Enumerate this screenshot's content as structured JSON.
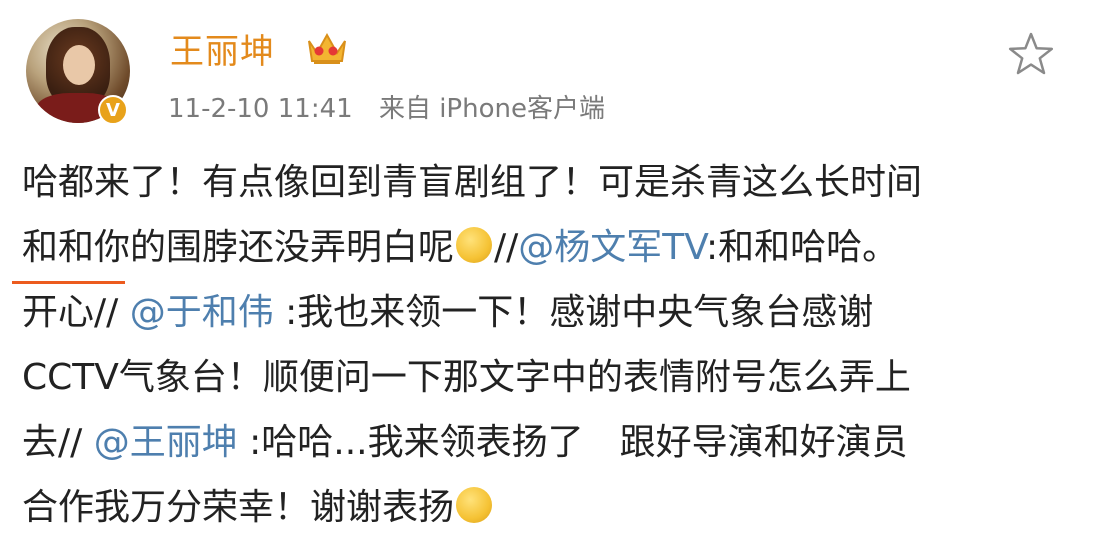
{
  "post": {
    "username": "王丽坤",
    "timestamp": "11-2-10 11:41",
    "source": "来自 iPhone客户端",
    "icons": {
      "verified": "verified-v-badge",
      "vip": "crown-icon",
      "favorite": "star-icon",
      "emoji": "smiley-emoji-icon"
    },
    "verified_badge_text": "V",
    "lines": [
      {
        "text": "哈都来了！有点像回到青盲剧组了！可是杀青这么长时间"
      },
      {
        "pre": "和和你的围脖还没弄明白呢",
        "sep": "//",
        "mention": "@杨文军TV",
        "post": ":和和哈哈。"
      },
      {
        "pre": "开心// ",
        "mention": "@于和伟",
        "post": " :我也来领一下！感谢中央气象台感谢"
      },
      {
        "text": "CCTV气象台！顺便问一下那文字中的表情附号怎么弄上"
      },
      {
        "pre": "去// ",
        "mention": "@王丽坤",
        "post": " :哈哈...我来领表扬了　跟好导演和好演员"
      },
      {
        "text": "合作我万分荣幸！谢谢表扬"
      }
    ]
  },
  "colors": {
    "username": "#e38a1c",
    "mention": "#4e7fae",
    "meta": "#7a7a7a",
    "underline": "#ec5b1e"
  }
}
